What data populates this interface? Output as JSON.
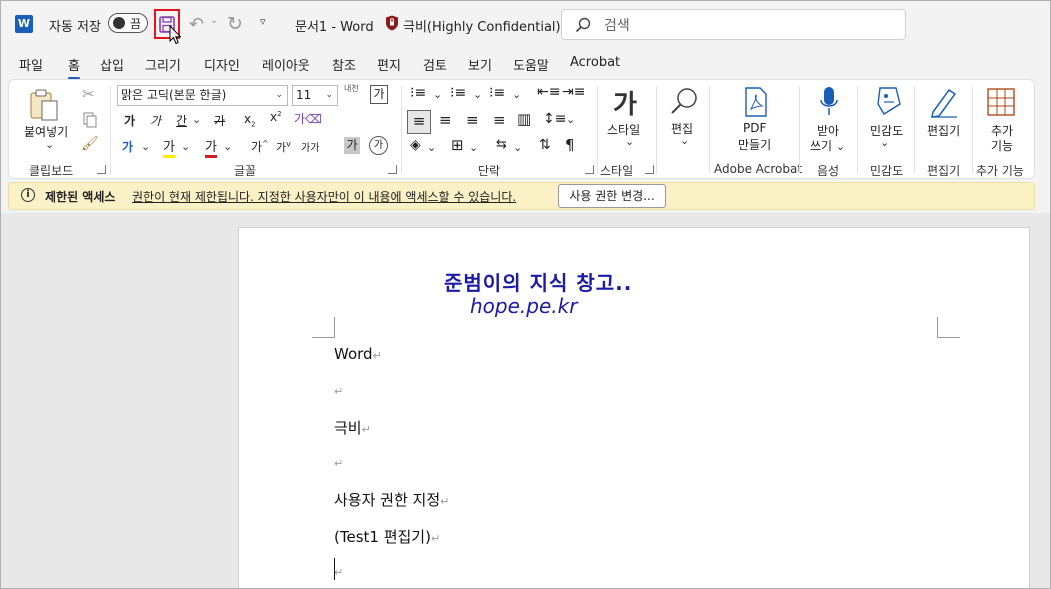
{
  "titlebar": {
    "app_logo": "W",
    "autosave_label": "자동 저장",
    "autosave_state": "끔",
    "doc_name": "문서1",
    "separator": "-",
    "app_name": "Word",
    "sensitivity_label": "극비(Highly Confidential)",
    "search_placeholder": "검색"
  },
  "tabs": [
    "파일",
    "홈",
    "삽입",
    "그리기",
    "디자인",
    "레이아웃",
    "참조",
    "편지",
    "검토",
    "보기",
    "도움말",
    "Acrobat"
  ],
  "active_tab": "홈",
  "ribbon": {
    "clipboard": {
      "paste": "붙여넣기",
      "group": "클립보드"
    },
    "font": {
      "font_name": "맑은 고딕(본문 한글)",
      "font_size": "11",
      "bold": "가",
      "italic": "가",
      "underline": "간",
      "strike": "가",
      "subscript": "x",
      "superscript": "x",
      "grow": "가",
      "shrink": "가",
      "case": "가가",
      "highlight_char": "가",
      "font_color_char": "가",
      "shade_char": "가",
      "enclose_char": "가",
      "phonetic": "내천",
      "group": "글꼴"
    },
    "paragraph": {
      "group": "단락"
    },
    "styles": {
      "label": "스타일",
      "group": "스타일"
    },
    "editing": {
      "label": "편집"
    },
    "adobe": {
      "label1": "PDF",
      "label2": "만들기",
      "group": "Adobe Acrobat"
    },
    "voice": {
      "label1": "받아",
      "label2": "쓰기",
      "group": "음성"
    },
    "sensitivity": {
      "label": "민감도",
      "group": "민감도"
    },
    "editor": {
      "label": "편집기",
      "group": "편집기"
    },
    "addins": {
      "label1": "추가",
      "label2": "기능",
      "group": "추가 기능"
    }
  },
  "infobar": {
    "title": "제한된 액세스",
    "message": "권한이 현재 제한됩니다. 지정한 사용자만이 이 내용에 액세스할 수 있습니다.",
    "button": "사용 권한 변경..."
  },
  "document": {
    "watermark_line1": "준범이의 지식 창고..",
    "watermark_line2": "hope.pe.kr",
    "paragraph_mark": "↵",
    "paragraphs": [
      "Word",
      "",
      "극비",
      "",
      "사용자 권한 지정",
      "(Test1 편집기)",
      ""
    ]
  },
  "colors": {
    "accent": "#1a5eb8",
    "highlight_box": "#e0151e",
    "infobar_bg": "#fbf1c7",
    "watermark": "#1a1aa8"
  }
}
